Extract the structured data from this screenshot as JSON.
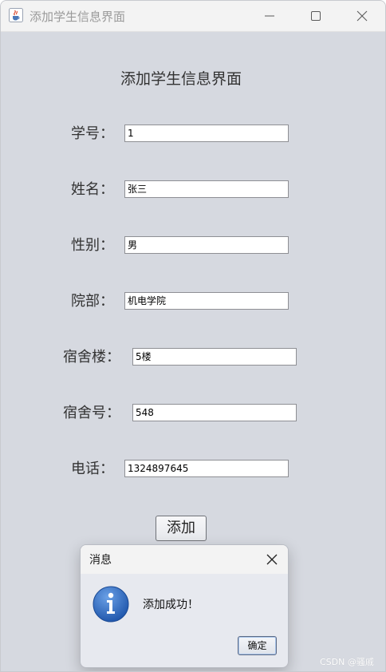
{
  "window": {
    "title": "添加学生信息界面",
    "icons": {
      "app": "java-cup-icon",
      "minimize": "minimize-icon",
      "maximize": "maximize-icon",
      "close": "close-icon"
    }
  },
  "form": {
    "title": "添加学生信息界面",
    "fields": [
      {
        "label": "学号：",
        "value": "1"
      },
      {
        "label": "姓名：",
        "value": "张三"
      },
      {
        "label": "性别：",
        "value": "男"
      },
      {
        "label": "院部：",
        "value": "机电学院"
      },
      {
        "label": "宿舍楼：",
        "value": "5楼"
      },
      {
        "label": "宿舍号：",
        "value": "548"
      },
      {
        "label": "电话：",
        "value": "1324897645"
      }
    ],
    "add_button": "添加"
  },
  "dialog": {
    "title": "消息",
    "icon": "info-icon",
    "message": "添加成功！",
    "ok_button": "确定"
  },
  "watermark": "CSDN @骚戚",
  "colors": {
    "background": "#d6d9e0",
    "dialog_background": "#e7e9ef",
    "info_icon_blue": "#2f6fc4"
  }
}
